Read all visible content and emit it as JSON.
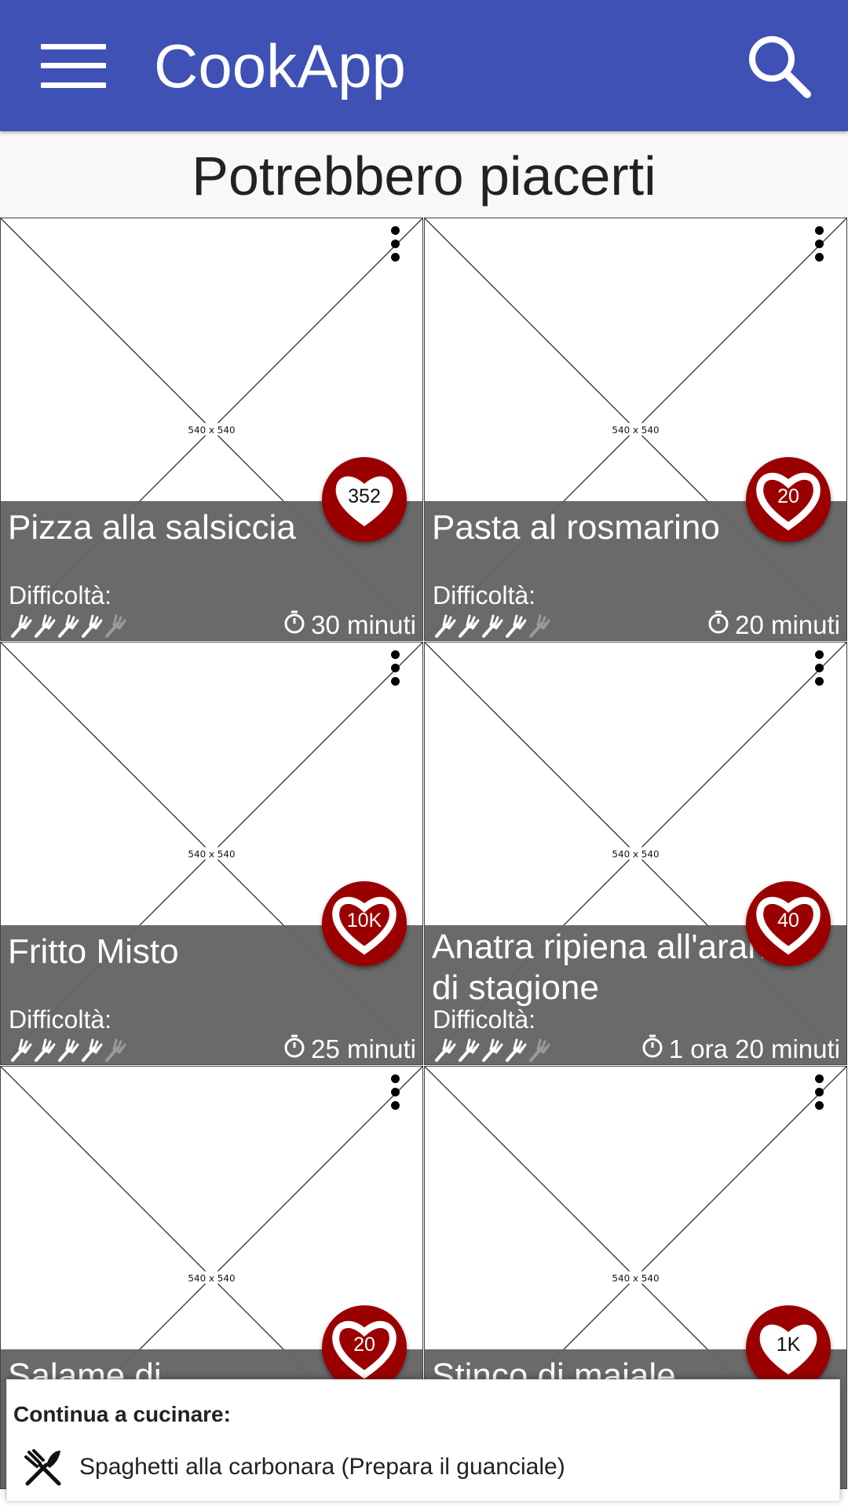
{
  "app_bar": {
    "title": "CookApp",
    "menu_icon": "menu-icon",
    "search_icon": "search-icon",
    "color": "#3f51b5"
  },
  "section": {
    "title": "Potrebbero piacerti"
  },
  "placeholder_label": "540 x 540",
  "difficulty_label": "Difficoltà:",
  "recipes": [
    {
      "name": "Pizza alla salsiccia",
      "likes": "352",
      "heart_style": "filled",
      "difficulty": 4,
      "difficulty_max": 5,
      "time": "30 minuti"
    },
    {
      "name": "Pasta al rosmarino",
      "likes": "20",
      "heart_style": "outline",
      "difficulty": 4,
      "difficulty_max": 5,
      "time": "20 minuti"
    },
    {
      "name": "Fritto Misto",
      "likes": "10K",
      "heart_style": "outline",
      "difficulty": 4,
      "difficulty_max": 5,
      "time": "25 minuti"
    },
    {
      "name": "Anatra ripiena all'arancia di stagione",
      "likes": "40",
      "heart_style": "outline",
      "difficulty": 4,
      "difficulty_max": 5,
      "time": "1 ora 20 minuti"
    },
    {
      "name": "Salame di",
      "likes": "20",
      "heart_style": "outline",
      "difficulty": 4,
      "difficulty_max": 5,
      "time": ""
    },
    {
      "name": "Stinco di maiale",
      "likes": "1K",
      "heart_style": "filled",
      "difficulty": 4,
      "difficulty_max": 5,
      "time": ""
    }
  ],
  "continue_cooking": {
    "title": "Continua a cucinare:",
    "icon": "cutlery-icon",
    "item": "Spaghetti alla carbonara (Prepara il guanciale)"
  },
  "colors": {
    "heart_button": "#9b0000",
    "info_overlay": "#646464"
  }
}
